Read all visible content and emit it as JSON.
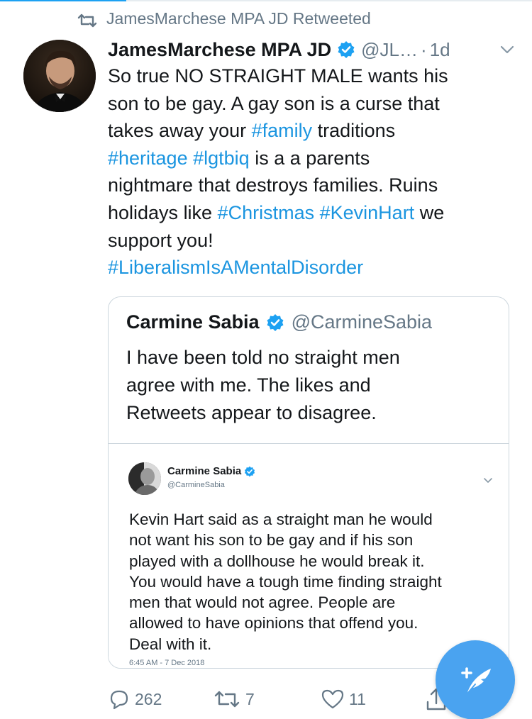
{
  "retweet_context": {
    "text": "JamesMarchese MPA JD Retweeted"
  },
  "tweet": {
    "author_name": "JamesMarchese MPA JD",
    "handle": "@JL…",
    "separator": "·",
    "time": "1d",
    "body_lines": [
      [
        {
          "t": "So true NO STRAIGHT MALE wants his",
          "tag": false
        }
      ],
      [
        {
          "t": "son to be gay.  A gay son is a curse that",
          "tag": false
        }
      ],
      [
        {
          "t": "takes away your ",
          "tag": false
        },
        {
          "t": "#family",
          "tag": true
        },
        {
          "t": " traditions",
          "tag": false
        }
      ],
      [
        {
          "t": "#heritage",
          "tag": true
        },
        {
          "t": "  ",
          "tag": false
        },
        {
          "t": "#lgtbiq",
          "tag": true
        },
        {
          "t": " is a a parents",
          "tag": false
        }
      ],
      [
        {
          "t": "nightmare that destroys families.  Ruins",
          "tag": false
        }
      ],
      [
        {
          "t": "holidays like ",
          "tag": false
        },
        {
          "t": "#Christmas",
          "tag": true
        },
        {
          "t": " ",
          "tag": false
        },
        {
          "t": "#KevinHart",
          "tag": true
        },
        {
          "t": " we",
          "tag": false
        }
      ],
      [
        {
          "t": "support you!",
          "tag": false
        }
      ],
      [
        {
          "t": "#LiberalismIsAMentalDisorder",
          "tag": true
        }
      ]
    ]
  },
  "quote": {
    "author_name": "Carmine Sabia",
    "handle": "@CarmineSabia",
    "body_lines": [
      "I have been told no straight men",
      "agree with me. The likes and",
      "Retweets appear to disagree."
    ],
    "embedded": {
      "author_name": "Carmine Sabia",
      "handle": "@CarmineSabia",
      "body_lines": [
        "Kevin Hart said as a straight man he would",
        "not want his son to be gay and if his son",
        "played with a dollhouse he would break it.",
        "You would have a tough time finding straight",
        "men that would not agree. People are",
        "allowed to have opinions that offend you.",
        "Deal with it."
      ],
      "timestamp": "6:45 AM - 7 Dec 2018"
    }
  },
  "actions": {
    "reply_count": "262",
    "retweet_count": "7",
    "like_count": "11"
  },
  "icons": {
    "retweet_context": "retweet-icon",
    "verified": "verified-badge-icon",
    "caret": "chevron-down-icon",
    "reply": "reply-icon",
    "retweet": "retweet-icon",
    "like": "heart-icon",
    "share": "share-icon",
    "compose": "compose-tweet-icon"
  },
  "colors": {
    "link": "#1b95e0",
    "secondary_text": "#657786",
    "verified": "#1da1f2",
    "fab": "#4aa3f0"
  }
}
